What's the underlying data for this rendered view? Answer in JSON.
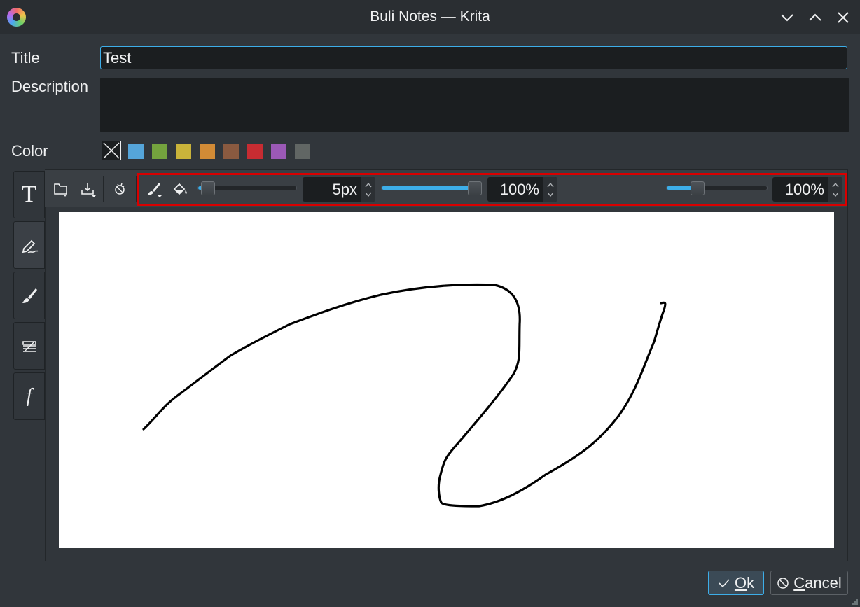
{
  "window": {
    "title": "Buli Notes — Krita",
    "app_icon": "krita-logo-icon",
    "controls": [
      "minimize-icon",
      "maximize-icon",
      "close-icon"
    ]
  },
  "form": {
    "title_label": "Title",
    "title_value": "Test",
    "description_label": "Description",
    "description_value": "",
    "color_label": "Color",
    "colors": [
      "#55a5da",
      "#74a33e",
      "#c9b33a",
      "#d28b36",
      "#8a5a40",
      "#c72c32",
      "#9b59b6",
      "#616664"
    ]
  },
  "side_tabs": [
    {
      "name": "text-tab",
      "icon": "text-T-icon",
      "active": false
    },
    {
      "name": "sketch-tab",
      "icon": "pencil-sketch-icon",
      "active": true
    },
    {
      "name": "brush-tab",
      "icon": "brush-icon",
      "active": false
    },
    {
      "name": "layers-tab",
      "icon": "layers-icon",
      "active": false
    },
    {
      "name": "function-tab",
      "icon": "function-f-icon",
      "active": false
    }
  ],
  "toolbar": {
    "icons": [
      "open-image-icon",
      "save-image-icon",
      "clear-canvas-icon",
      "brush-color-icon",
      "fill-color-icon"
    ],
    "brush_size": {
      "value": "5px",
      "level": 0.04
    },
    "opacity": {
      "value": "100%",
      "level": 1.0
    },
    "flow": {
      "value": "100%",
      "level": 0.28
    }
  },
  "buttons": {
    "ok_label": "Ok",
    "cancel_label": "Cancel"
  },
  "colors": {
    "background": "#31363b",
    "field": "#1b1e20",
    "accent": "#3daee9",
    "highlight_box": "#d90000"
  }
}
